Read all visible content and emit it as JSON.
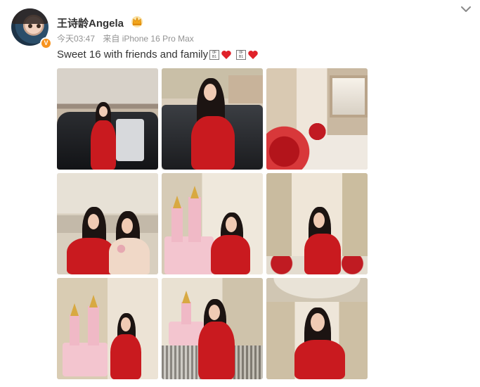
{
  "post": {
    "username": "王诗龄Angela",
    "time": "今天03:47",
    "source": "来自 iPhone 16 Pro Max",
    "text": "Sweet 16 with friends and family",
    "emoji_box_text": "0F\nB1",
    "heart_color": "#e0222a",
    "verified_badge": "V"
  },
  "colors": {
    "dress_red": "#c91a1f",
    "meta_gray": "#939393",
    "verified_orange": "#f7931e"
  },
  "photos": [
    {
      "id": 1,
      "label": "car-entrance"
    },
    {
      "id": 2,
      "label": "car-wave"
    },
    {
      "id": 3,
      "label": "dining-room"
    },
    {
      "id": 4,
      "label": "two-women"
    },
    {
      "id": 5,
      "label": "castle-cake-pose"
    },
    {
      "id": 6,
      "label": "hall-portrait"
    },
    {
      "id": 7,
      "label": "cake-side"
    },
    {
      "id": 8,
      "label": "cake-front"
    },
    {
      "id": 9,
      "label": "hall-smile"
    }
  ]
}
